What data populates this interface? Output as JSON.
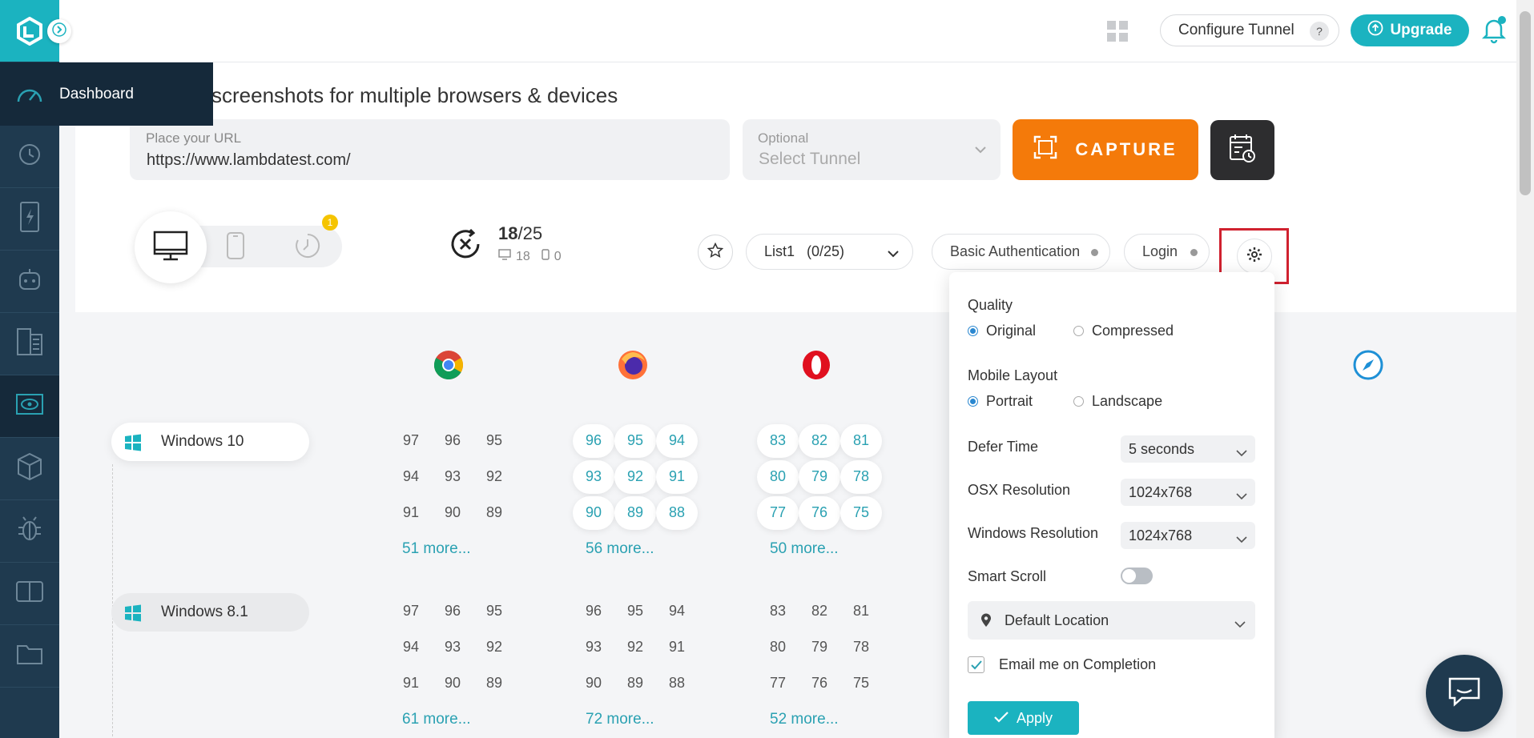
{
  "sidebar": {
    "active_popup_label": "Dashboard",
    "items": [
      "dashboard",
      "realtime",
      "automation",
      "hyperexecute",
      "visual-ui",
      "screenshots",
      "smartui",
      "issue-tracker",
      "compare",
      "files"
    ]
  },
  "topbar": {
    "configure_tunnel": "Configure Tunnel",
    "help": "?",
    "upgrade": "Upgrade"
  },
  "page": {
    "title": "screenshots for multiple browsers & devices"
  },
  "url": {
    "placeholder": "Place your URL",
    "value": "https://www.lambdatest.com/"
  },
  "tunnel": {
    "placeholder": "Optional",
    "value": "Select Tunnel"
  },
  "capture_label": "CAPTURE",
  "device_toggle": {
    "badge": "1"
  },
  "selection_count": {
    "selected": "18",
    "total": "/25",
    "desktop": "18",
    "mobile": "0"
  },
  "list_select": "List1   (0/25)",
  "basic_auth": "Basic Authentication",
  "login": "Login",
  "os_rows": [
    {
      "name": "Windows 10",
      "chrome": [
        "97",
        "96",
        "95",
        "94",
        "93",
        "92",
        "91",
        "90",
        "89"
      ],
      "chrome_more": "51 more...",
      "firefox": [
        "96",
        "95",
        "94",
        "93",
        "92",
        "91",
        "90",
        "89",
        "88"
      ],
      "firefox_more": "56 more...",
      "opera": [
        "83",
        "82",
        "81",
        "80",
        "79",
        "78",
        "77",
        "76",
        "75"
      ],
      "opera_more": "50 more..."
    },
    {
      "name": "Windows 8.1",
      "chrome": [
        "97",
        "96",
        "95",
        "94",
        "93",
        "92",
        "91",
        "90",
        "89"
      ],
      "chrome_more": "61 more...",
      "firefox": [
        "96",
        "95",
        "94",
        "93",
        "92",
        "91",
        "90",
        "89",
        "88"
      ],
      "firefox_more": "72 more...",
      "opera": [
        "83",
        "82",
        "81",
        "80",
        "79",
        "78",
        "77",
        "76",
        "75"
      ],
      "opera_more": "52 more..."
    }
  ],
  "settings": {
    "quality_label": "Quality",
    "quality_original": "Original",
    "quality_compressed": "Compressed",
    "mobile_layout_label": "Mobile Layout",
    "portrait": "Portrait",
    "landscape": "Landscape",
    "defer_time_label": "Defer Time",
    "defer_time_value": "5 seconds",
    "osx_res_label": "OSX Resolution",
    "osx_res_value": "1024x768",
    "win_res_label": "Windows Resolution",
    "win_res_value": "1024x768",
    "smart_scroll_label": "Smart Scroll",
    "location_value": "Default Location",
    "email_label": "Email me on Completion",
    "apply": "Apply"
  }
}
